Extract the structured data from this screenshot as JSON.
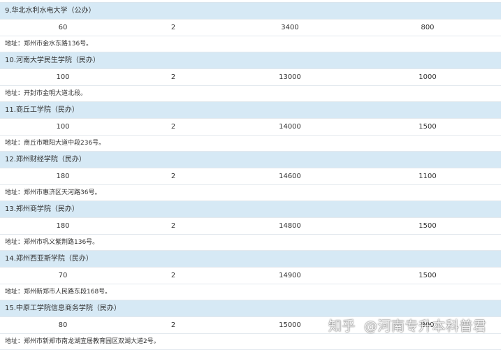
{
  "schools": [
    {
      "name": "9.华北水利水电大学（公办）",
      "values": [
        "60",
        "2",
        "3400",
        "800"
      ],
      "address": "地址：郑州市金水东路136号。"
    },
    {
      "name": "10.河南大学民生学院（民办）",
      "values": [
        "100",
        "2",
        "13000",
        "1000"
      ],
      "address": "地址：开封市金明大道北段。"
    },
    {
      "name": "11.商丘工学院（民办）",
      "values": [
        "100",
        "2",
        "14000",
        "1500"
      ],
      "address": "地址：商丘市睢阳大道中段236号。"
    },
    {
      "name": "12.郑州财经学院（民办）",
      "values": [
        "180",
        "2",
        "14600",
        "1100"
      ],
      "address": "地址：郑州市惠济区天河路36号。"
    },
    {
      "name": "13.郑州商学院（民办）",
      "values": [
        "180",
        "2",
        "14800",
        "1500"
      ],
      "address": "地址：郑州市巩义紫荆路136号。"
    },
    {
      "name": "14.郑州西亚斯学院（民办）",
      "values": [
        "70",
        "2",
        "14900",
        "1500"
      ],
      "address": "地址：郑州新郑市人民路东段168号。"
    },
    {
      "name": "15.中原工学院信息商务学院（民办）",
      "values": [
        "80",
        "2",
        "15000",
        "800"
      ],
      "address": "地址：郑州市新郑市南龙湖宜居教育园区双湖大道2号。"
    }
  ],
  "watermark": {
    "brand": "知乎",
    "author": "@河南专升本科普君"
  }
}
